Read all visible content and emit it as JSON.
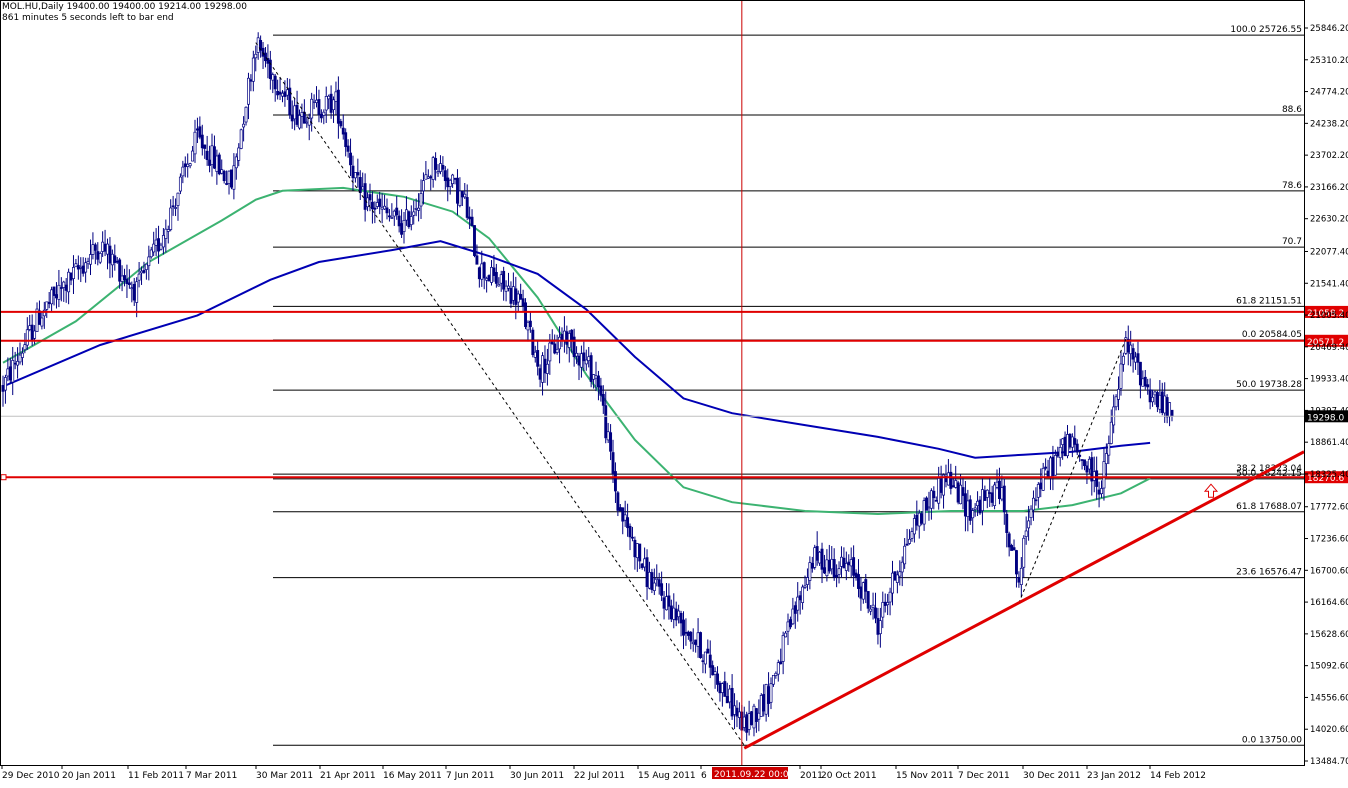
{
  "header": {
    "symbol_line": "MOL.HU,Daily  19400.00 19400.00 19214.00 19298.00",
    "timer_line": "861 minutes 5 seconds left to bar end"
  },
  "colors": {
    "background": "#ffffff",
    "candle_bull_body": "#ffffff",
    "candle_bear_body": "#000080",
    "candle_outline": "#000080",
    "ma_fast": "#3cb371",
    "ma_slow": "#0000b4",
    "horizontal_level": "#e00000",
    "trendline": "#e00000",
    "fib_line": "#000000",
    "crosshair": "#cc0000"
  },
  "chart_data": {
    "type": "candlestick",
    "title": "MOL.HU,Daily",
    "ylim": [
      13484.7,
      25846.2
    ],
    "y_tick_labels": [
      "25846.20",
      "25310.20",
      "24774.20",
      "24238.20",
      "23702.20",
      "23166.20",
      "22630.20",
      "22077.40",
      "21541.40",
      "21005.40",
      "20469.40",
      "19933.40",
      "19397.40",
      "18861.40",
      "18325.40",
      "17772.60",
      "17236.60",
      "16700.60",
      "16164.60",
      "15628.60",
      "15092.60",
      "14556.60",
      "14020.60",
      "13484.70"
    ],
    "x_tick_labels": [
      "29 Dec 2010",
      "20 Jan 2011",
      "11 Feb 2011",
      "7 Mar 2011",
      "30 Mar 2011",
      "21 Apr 2011",
      "16 May 2011",
      "7 Jun 2011",
      "30 Jun 2011",
      "22 Jul 2011",
      "15 Aug 2011",
      "6",
      "2011.09.22 00:00",
      "2011",
      "20 Oct 2011",
      "15 Nov 2011",
      "7 Dec 2011",
      "30 Dec 2011",
      "23 Jan 2012",
      "14 Feb 2012"
    ],
    "ohlc_last": {
      "open": 19400.0,
      "high": 19400.0,
      "low": 19214.0,
      "close": 19298.0
    },
    "price_waypoints": [
      [
        0,
        19800
      ],
      [
        15,
        21000
      ],
      [
        40,
        22200
      ],
      [
        55,
        21400
      ],
      [
        65,
        22300
      ],
      [
        80,
        24000
      ],
      [
        94,
        23200
      ],
      [
        104,
        25600
      ],
      [
        120,
        24400
      ],
      [
        137,
        24600
      ],
      [
        147,
        23000
      ],
      [
        165,
        22500
      ],
      [
        178,
        23600
      ],
      [
        190,
        22900
      ],
      [
        196,
        21800
      ],
      [
        212,
        21300
      ],
      [
        221,
        20100
      ],
      [
        231,
        20700
      ],
      [
        245,
        19900
      ],
      [
        253,
        17800
      ],
      [
        265,
        16600
      ],
      [
        287,
        15400
      ],
      [
        305,
        14050
      ],
      [
        315,
        14650
      ],
      [
        333,
        16900
      ],
      [
        350,
        16700
      ],
      [
        360,
        15800
      ],
      [
        374,
        17400
      ],
      [
        388,
        18300
      ],
      [
        398,
        17700
      ],
      [
        410,
        18100
      ],
      [
        418,
        16500
      ],
      [
        423,
        17900
      ],
      [
        438,
        18900
      ],
      [
        452,
        18100
      ],
      [
        458,
        19600
      ],
      [
        462,
        20500
      ],
      [
        472,
        19700
      ],
      [
        481,
        19298
      ]
    ],
    "fib_levels": [
      {
        "label": "100.0  25726.55",
        "value": 25726.55
      },
      {
        "label": "88.6",
        "value": 24380
      },
      {
        "label": "78.6",
        "value": 23100
      },
      {
        "label": "70.7",
        "value": 22150
      },
      {
        "label": "61.8  21151.51",
        "value": 21151.51
      },
      {
        "label": "0.0  20584.05",
        "value": 20584.05
      },
      {
        "label": "50.0  19738.28",
        "value": 19738.28
      },
      {
        "label": "38.2  18323.04",
        "value": 18323.04
      },
      {
        "label": "50.0  18242.15",
        "value": 18242.15
      },
      {
        "label": "61.8  17688.07",
        "value": 17688.07
      },
      {
        "label": "23.6  16576.47",
        "value": 16576.47
      },
      {
        "label": "0.0  13750.00",
        "value": 13750.0
      }
    ],
    "horizontal_levels": [
      {
        "label": "21058.2",
        "value": 21058.2
      },
      {
        "label": "20571.2",
        "value": 20571.2
      },
      {
        "label": "18270.6",
        "value": 18270.6
      }
    ],
    "current_price_label": "19298.0",
    "moving_averages": [
      {
        "color": "#3cb371",
        "points": [
          [
            0,
            20200
          ],
          [
            30,
            20900
          ],
          [
            60,
            21900
          ],
          [
            90,
            22600
          ],
          [
            104,
            22950
          ],
          [
            115,
            23100
          ],
          [
            140,
            23150
          ],
          [
            165,
            23000
          ],
          [
            185,
            22750
          ],
          [
            200,
            22300
          ],
          [
            220,
            21300
          ],
          [
            240,
            20000
          ],
          [
            260,
            18900
          ],
          [
            280,
            18100
          ],
          [
            300,
            17850
          ],
          [
            330,
            17700
          ],
          [
            360,
            17650
          ],
          [
            390,
            17700
          ],
          [
            420,
            17700
          ],
          [
            440,
            17800
          ],
          [
            460,
            18000
          ],
          [
            472,
            18250
          ]
        ]
      },
      {
        "color": "#0000b4",
        "points": [
          [
            0,
            19800
          ],
          [
            40,
            20500
          ],
          [
            80,
            21000
          ],
          [
            110,
            21600
          ],
          [
            130,
            21900
          ],
          [
            160,
            22100
          ],
          [
            180,
            22250
          ],
          [
            200,
            22000
          ],
          [
            220,
            21700
          ],
          [
            240,
            21100
          ],
          [
            260,
            20300
          ],
          [
            280,
            19600
          ],
          [
            300,
            19350
          ],
          [
            330,
            19150
          ],
          [
            360,
            18950
          ],
          [
            385,
            18750
          ],
          [
            400,
            18600
          ],
          [
            420,
            18650
          ],
          [
            440,
            18700
          ],
          [
            460,
            18800
          ],
          [
            472,
            18850
          ]
        ]
      }
    ],
    "trendline": {
      "from": [
        305,
        13700
      ],
      "to": [
        481,
        18700
      ]
    },
    "dashed_lines": [
      {
        "from": [
          104,
          25600
        ],
        "to": [
          305,
          13750
        ]
      },
      {
        "from": [
          418,
          16150
        ],
        "to": [
          462,
          20600
        ]
      }
    ],
    "vertical_marker_index": 304
  }
}
